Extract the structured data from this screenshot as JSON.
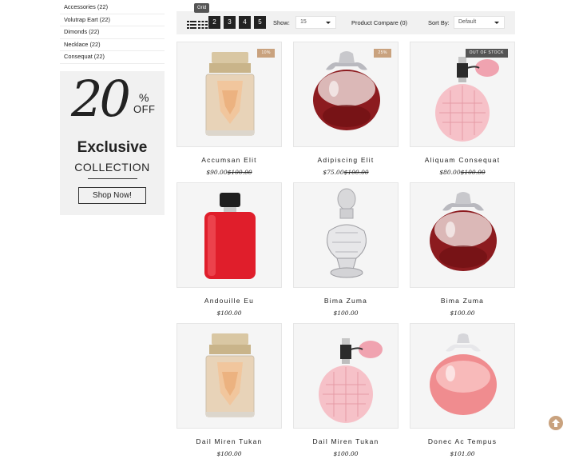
{
  "sidebar": {
    "categories": [
      "Accessories (22)",
      "Volutrap Eart (22)",
      "Dimonds (22)",
      "Necklace (22)",
      "Consequat (22)"
    ]
  },
  "banner": {
    "number": "20",
    "percent": "%",
    "off": "OFF",
    "title": "Exclusive",
    "subtitle": "COLLECTION",
    "button": "Shop Now!"
  },
  "toolbar": {
    "view_tooltip": "Grid",
    "pages": [
      "2",
      "3",
      "4",
      "5"
    ],
    "show_label": "Show:",
    "show_value": "15",
    "compare_label": "Product Compare (0)",
    "sort_label": "Sort By:",
    "sort_value": "Default"
  },
  "products": [
    {
      "name": "Accumsan Elit",
      "price": "$90.00",
      "old_price": "$100.00",
      "badge": "10%",
      "badge_type": "sale",
      "image": "gold-cap-perfume"
    },
    {
      "name": "Adipiscing Elit",
      "price": "$75.00",
      "old_price": "$100.00",
      "badge": "25%",
      "badge_type": "sale",
      "image": "apple-red-perfume"
    },
    {
      "name": "Aliquam Consequat",
      "price": "$80.00",
      "old_price": "$100.00",
      "badge": "OUT OF STOCK",
      "badge_type": "oos",
      "image": "atomizer-pink-perfume"
    },
    {
      "name": "Andouille Eu",
      "price": "$100.00",
      "old_price": "",
      "badge": "",
      "badge_type": "",
      "image": "red-square-perfume"
    },
    {
      "name": "Bima Zuma",
      "price": "$100.00",
      "old_price": "",
      "badge": "",
      "badge_type": "",
      "image": "crystal-perfume"
    },
    {
      "name": "Bima Zuma",
      "price": "$100.00",
      "old_price": "",
      "badge": "",
      "badge_type": "",
      "image": "apple-red-perfume"
    },
    {
      "name": "Dail Miren Tukan",
      "price": "$100.00",
      "old_price": "",
      "badge": "",
      "badge_type": "",
      "image": "gold-cap-perfume"
    },
    {
      "name": "Dail Miren Tukan",
      "price": "$100.00",
      "old_price": "",
      "badge": "",
      "badge_type": "",
      "image": "atomizer-pink-perfume"
    },
    {
      "name": "Donec Ac Tempus",
      "price": "$101.00",
      "old_price": "",
      "badge": "",
      "badge_type": "",
      "image": "apple-pink-perfume"
    }
  ],
  "colors": {
    "accent": "#c9a27e",
    "badge_dark": "#555555",
    "pagination": "#222222",
    "toolbar_bg": "#f1f1f1"
  },
  "icons": {
    "list_view": "list-view-icon",
    "grid_view": "grid-view-icon",
    "scroll_top": "arrow-up-circle-icon"
  }
}
